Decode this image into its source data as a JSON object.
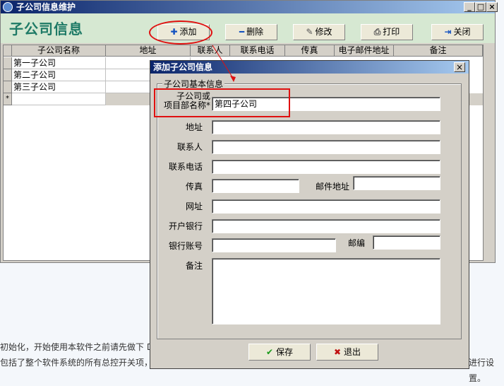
{
  "main_window": {
    "title": "子公司信息维护",
    "heading": "子公司信息",
    "window_controls": {
      "minimize": "_",
      "maximize": "□",
      "close": "×"
    },
    "toolbar": {
      "add": "添加",
      "delete": "删除",
      "edit": "修改",
      "print": "打印",
      "close": "关闭"
    },
    "grid": {
      "columns": [
        "子公司名称",
        "地址",
        "联系人",
        "联系电话",
        "传真",
        "电子邮件地址",
        "备注"
      ],
      "rows": [
        "第一子公司",
        "第二子公司",
        "第三子公司"
      ],
      "new_row_marker": "*"
    }
  },
  "status": {
    "line1": "初始化，开始使用本软件之前请先做下 D",
    "line2": "包括了整个软件系统的所有总控开关项，",
    "line2_right": "进行设置。"
  },
  "dialog": {
    "title": "添加子公司信息",
    "close": "×",
    "group_title": "子公司基本信息",
    "labels": {
      "name_line1": "子公司或",
      "name_line2": "项目部名称*",
      "address": "地址",
      "contact": "联系人",
      "phone": "联系电话",
      "fax": "传真",
      "email": "邮件地址",
      "website": "网址",
      "bank": "开户银行",
      "account": "银行账号",
      "postcode": "邮编",
      "notes": "备注"
    },
    "values": {
      "name": "第四子公司",
      "address": "",
      "contact": "",
      "phone": "",
      "fax": "",
      "email": "",
      "website": "",
      "bank": "",
      "account": "",
      "postcode": "",
      "notes": ""
    },
    "buttons": {
      "save": "保存",
      "exit": "退出"
    }
  },
  "colors": {
    "annotation": "#e01010",
    "title_bar": "#0a246a",
    "heading": "#1e7a66"
  }
}
